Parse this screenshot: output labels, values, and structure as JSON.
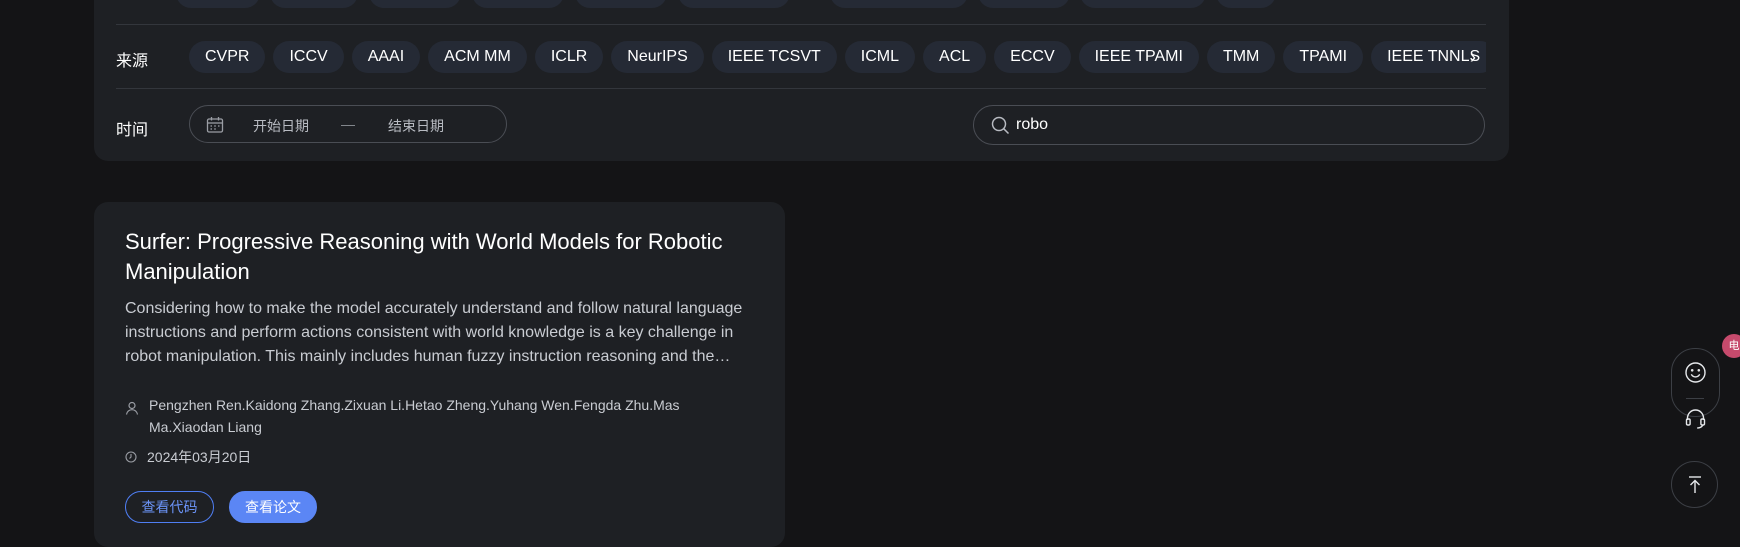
{
  "filters": {
    "source_label": "来源",
    "time_label": "时间",
    "sources": [
      "CVPR",
      "ICCV",
      "AAAI",
      "ACM MM",
      "ICLR",
      "NeurIPS",
      "IEEE TCSVT",
      "ICML",
      "ACL",
      "ECCV",
      "IEEE TPAMI",
      "TMM",
      "TPAMI",
      "IEEE TNNLS"
    ],
    "more_icon": "chevron-right-icon",
    "date_range": {
      "start_placeholder": "开始日期",
      "separator": "—",
      "end_placeholder": "结束日期",
      "icon": "calendar-icon"
    },
    "search": {
      "value": "robo",
      "icon": "search-icon"
    }
  },
  "results": [
    {
      "title": "Surfer: Progressive Reasoning with World Models for Robotic Manipulation",
      "abstract": "Considering how to make the model accurately understand and follow natural language instructions and perform actions consistent with world knowledge is a key challenge in robot manipulation. This mainly includes human fuzzy instruction reasoning and the following of physical knowledge.",
      "authors": "Pengzhen Ren.Kaidong Zhang.Zixuan Li.Hetao Zheng.Yuhang Wen.Fengda Zhu.Mas Ma.Xiaodan Liang",
      "date": "2024年03月20日",
      "view_code_label": "查看代码",
      "view_paper_label": "查看论文"
    }
  ],
  "floating": {
    "feedback_icon": "smile-icon",
    "support_icon": "headset-icon",
    "back_to_top_icon": "arrow-up-to-top-icon",
    "edge_badge_text": "电"
  },
  "colors": {
    "background": "#141416",
    "panel": "#1e2024",
    "chip": "#252a35",
    "accent": "#5b86f5"
  }
}
